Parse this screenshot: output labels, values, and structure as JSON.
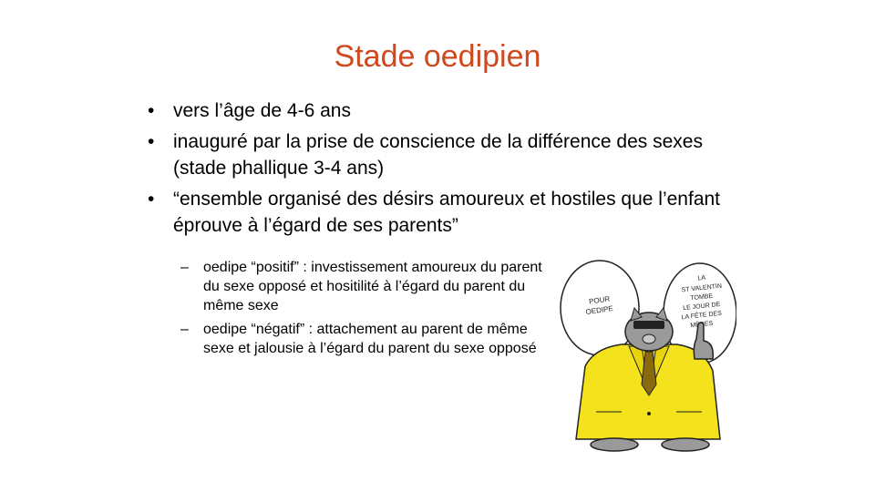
{
  "slide": {
    "title": "Stade oedipien",
    "bullets": [
      "vers l’âge de 4-6 ans",
      "inauguré par la prise de conscience de la différence des sexes (stade phallique 3-4 ans)",
      "“ensemble organisé des désirs amoureux et hostiles que l’enfant éprouve à l’égard de ses parents”"
    ],
    "sub_bullets": [
      "oedipe “positif” : investissement amoureux du parent du sexe opposé et hositilité à l’égard du parent du même sexe",
      "oedipe “négatif” : attachement au parent de même sexe et jalousie à l’égard du parent du sexe opposé"
    ],
    "bullet_glyph": "•",
    "sub_glyph": "–",
    "cartoon": {
      "left_bubble": [
        "POUR",
        "OEDIPE"
      ],
      "right_bubble": [
        "LA",
        "ST VALENTIN",
        "TOMBE",
        "LE JOUR DE",
        "LA FÊTE DES",
        "MÈRES"
      ]
    },
    "colors": {
      "title": "#d1481f",
      "coat": "#f3e21c",
      "tie": "#8a6a10"
    }
  }
}
